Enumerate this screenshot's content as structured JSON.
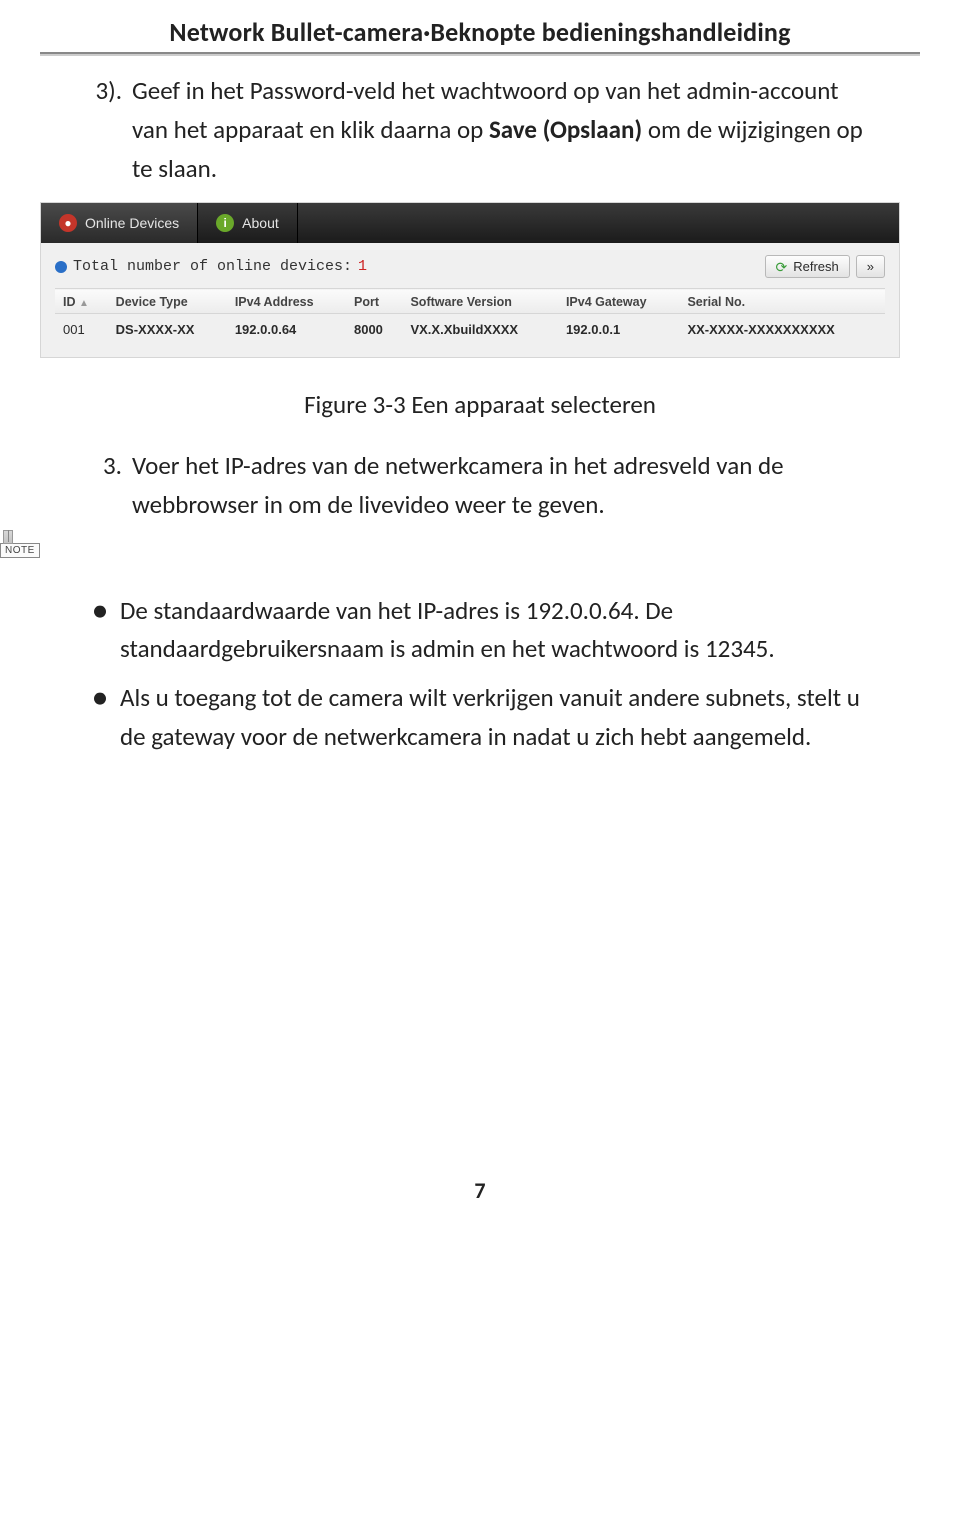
{
  "header": {
    "title": "Network Bullet-camera·Beknopte bedieningshandleiding"
  },
  "step3": {
    "num": "3).",
    "text_a": "Geef in het Password-veld het wachtwoord op van het admin-account van het apparaat en klik daarna op ",
    "text_b": "Save (Opslaan)",
    "text_c": " om de wijzigingen op te slaan."
  },
  "screenshot": {
    "tabs": {
      "online": "Online Devices",
      "about": "About"
    },
    "total_label": "Total number of online devices:",
    "total_value": "1",
    "refresh": "Refresh",
    "more": "»",
    "headers": {
      "id": "ID",
      "type": "Device Type",
      "ip": "IPv4 Address",
      "port": "Port",
      "sw": "Software Version",
      "gw": "IPv4 Gateway",
      "serial": "Serial No."
    },
    "row": {
      "id": "001",
      "type": "DS-XXXX-XX",
      "ip": "192.0.0.64",
      "port": "8000",
      "sw": "VX.X.XbuildXXXX",
      "gw": "192.0.0.1",
      "serial": "XX-XXXX-XXXXXXXXXX"
    }
  },
  "caption": "Figure 3-3 Een apparaat selecteren",
  "step3b": {
    "num": "3.",
    "text": "Voer het IP-adres van de netwerkcamera in het adresveld van de webbrowser in om de livevideo weer te geven."
  },
  "note_label": "NOTE",
  "bullets": [
    "De standaardwaarde van het IP-adres is 192.0.0.64. De standaardgebruikersnaam is admin en het wachtwoord is 12345.",
    "Als u toegang tot de camera wilt verkrijgen vanuit andere subnets, stelt u de gateway voor de netwerkcamera in nadat u zich hebt aangemeld."
  ],
  "page": "7"
}
